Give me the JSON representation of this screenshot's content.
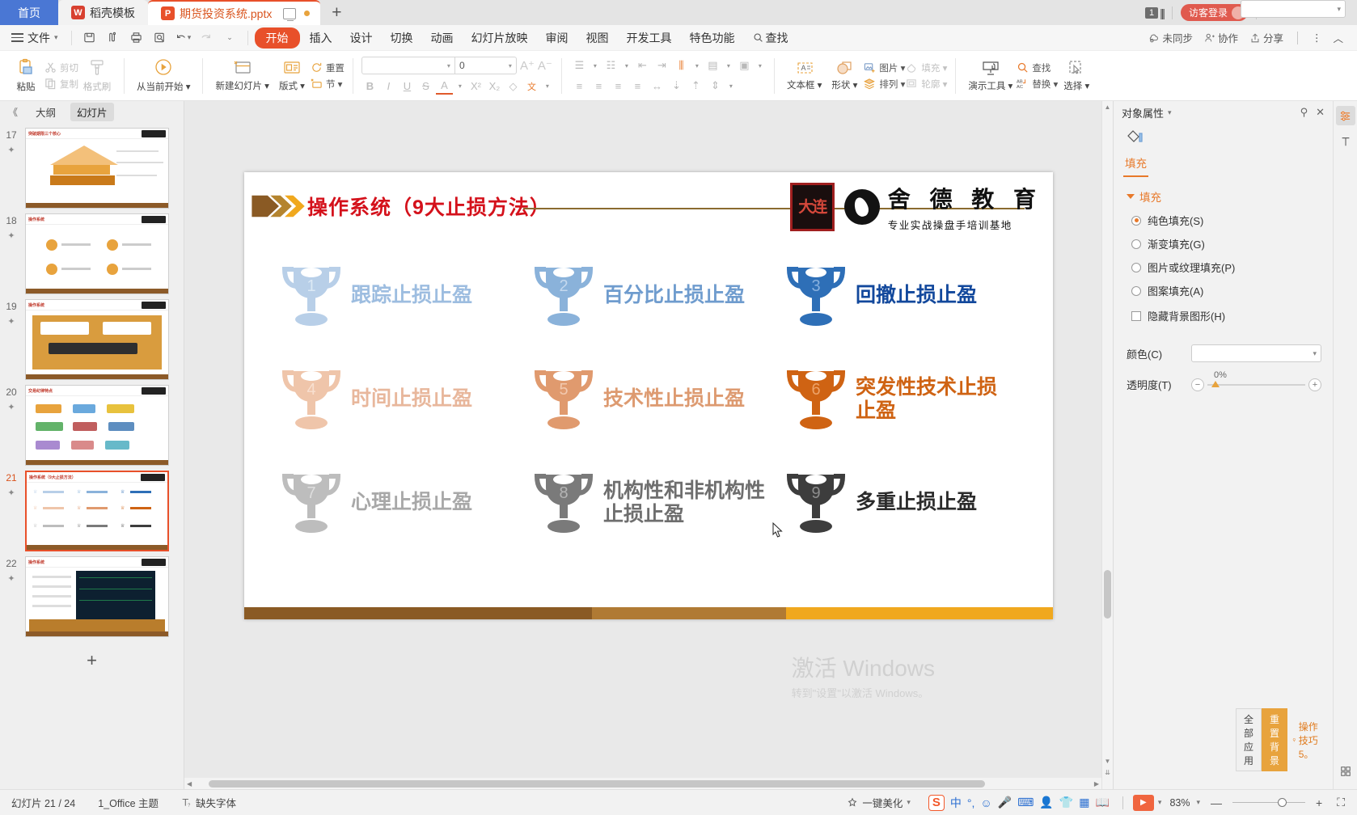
{
  "window": {
    "tabs": [
      {
        "label": "首页",
        "kind": "home"
      },
      {
        "label": "稻壳模板",
        "kind": "plain",
        "icon": "wps-dock-icon"
      },
      {
        "label": "期货投资系统.pptx",
        "kind": "active",
        "icon": "ppt-icon"
      }
    ],
    "new_tab": "+",
    "page_badge": "1",
    "guest_label": "访客登录",
    "minimize": "—",
    "restore": "❐",
    "close": "✕"
  },
  "menubar": {
    "file_label": "文件",
    "quick_icons": [
      "save-icon",
      "print-direct-icon",
      "print-icon",
      "print-preview-icon",
      "undo-icon",
      "redo-icon",
      "customize-icon"
    ],
    "items": [
      "开始",
      "插入",
      "设计",
      "切换",
      "动画",
      "幻灯片放映",
      "审阅",
      "视图",
      "开发工具",
      "特色功能"
    ],
    "selected": "开始",
    "search_label": "查找",
    "right": [
      {
        "label": "未同步",
        "icon": "cloud-sync-icon"
      },
      {
        "label": "协作",
        "icon": "collaborate-icon"
      },
      {
        "label": "分享",
        "icon": "share-icon"
      }
    ],
    "more": "⋮",
    "collapse": "︿"
  },
  "ribbon": {
    "paste": "粘贴",
    "cut": "剪切",
    "copy": "复制",
    "format_painter": "格式刷",
    "start_from_current": "从当前开始",
    "new_slide": "新建幻灯片",
    "layout": "版式",
    "section": "节",
    "reset": "重置",
    "font_name": "",
    "font_name_placeholder": "",
    "font_size": "0",
    "grow_font": "A⁺",
    "shrink_font": "A⁻",
    "bold": "B",
    "italic": "I",
    "underline": "U",
    "strike": "S",
    "font_color": "A",
    "superscript": "X²",
    "subscript": "X₂",
    "clear_format": "◇",
    "pinyin": "文",
    "textbox": "文本框",
    "shape": "形状",
    "picture": "图片",
    "fill": "填充",
    "arrange": "排列",
    "outline": "轮廓",
    "present_tools": "演示工具",
    "find": "查找",
    "replace": "替换",
    "select": "选择"
  },
  "left_panel": {
    "collapse": "《",
    "tab_outline": "大纲",
    "tab_slides": "幻灯片",
    "slides": [
      {
        "num": "17",
        "title": "突破期限三个核心",
        "current": false
      },
      {
        "num": "18",
        "title": "操作系统",
        "current": false
      },
      {
        "num": "19",
        "title": "操作系统",
        "current": false
      },
      {
        "num": "20",
        "title": "交易纪律特点",
        "current": false
      },
      {
        "num": "21",
        "title": "操作系统（9大止损方法）",
        "current": true
      },
      {
        "num": "22",
        "title": "操作系统",
        "current": false
      }
    ],
    "add_slide": "+"
  },
  "slide": {
    "title": "操作系统（9大止损方法）",
    "brand_name": "舍 德 教 育",
    "brand_sub": "专业实战操盘手培训基地",
    "seal_text": "大连",
    "items": [
      {
        "num": "1",
        "label": "跟踪止损止盈",
        "color": "#b8cfe8"
      },
      {
        "num": "2",
        "label": "百分比止损止盈",
        "color": "#8ab2da"
      },
      {
        "num": "3",
        "label": "回撤止损止盈",
        "color": "#2e6fb7"
      },
      {
        "num": "4",
        "label": "时间止损止盈",
        "color": "#efc5aa"
      },
      {
        "num": "5",
        "label": "技术性止损止盈",
        "color": "#e09a6e"
      },
      {
        "num": "6",
        "label": "突发性技术止损止盈",
        "color": "#cf6313"
      },
      {
        "num": "7",
        "label": "心理止损止盈",
        "color": "#bdbdbd"
      },
      {
        "num": "8",
        "label": "机构性和非机构性止损止盈",
        "color": "#7a7a7a"
      },
      {
        "num": "9",
        "label": "多重止损止盈",
        "color": "#3d3d3d"
      }
    ]
  },
  "right_panel": {
    "title": "对象属性",
    "tab_fill": "填充",
    "section_fill": "填充",
    "options": [
      {
        "label": "纯色填充(S)",
        "selected": true
      },
      {
        "label": "渐变填充(G)",
        "selected": false
      },
      {
        "label": "图片或纹理填充(P)",
        "selected": false
      },
      {
        "label": "图案填充(A)",
        "selected": false
      }
    ],
    "hide_bg_label": "隐藏背景图形(H)",
    "color_label": "颜色(C)",
    "opacity_label": "透明度(T)",
    "opacity_value": "0%",
    "pin": "pin-icon",
    "close": "✕"
  },
  "rail": {
    "items": [
      "properties-panel-icon",
      "text-panel-icon"
    ]
  },
  "watermark": {
    "line1": "激活 Windows",
    "line2": "转到\"设置\"以激活 Windows。"
  },
  "float_toolbar": {
    "apply_all": "全部应用",
    "reset_bg": "重置背景",
    "tips": "操作技巧5。"
  },
  "statusbar": {
    "slide_count": "幻灯片 21 / 24",
    "theme": "1_Office 主题",
    "missing_font": "缺失字体",
    "beautify": "一键美化",
    "ime": [
      "中",
      "°,",
      "☺",
      "🎤",
      "⌨",
      "👤",
      "👕",
      "▦",
      "📖"
    ],
    "zoom": "83%",
    "zoom_minus": "—",
    "zoom_plus": "+",
    "fit": "⛶"
  }
}
